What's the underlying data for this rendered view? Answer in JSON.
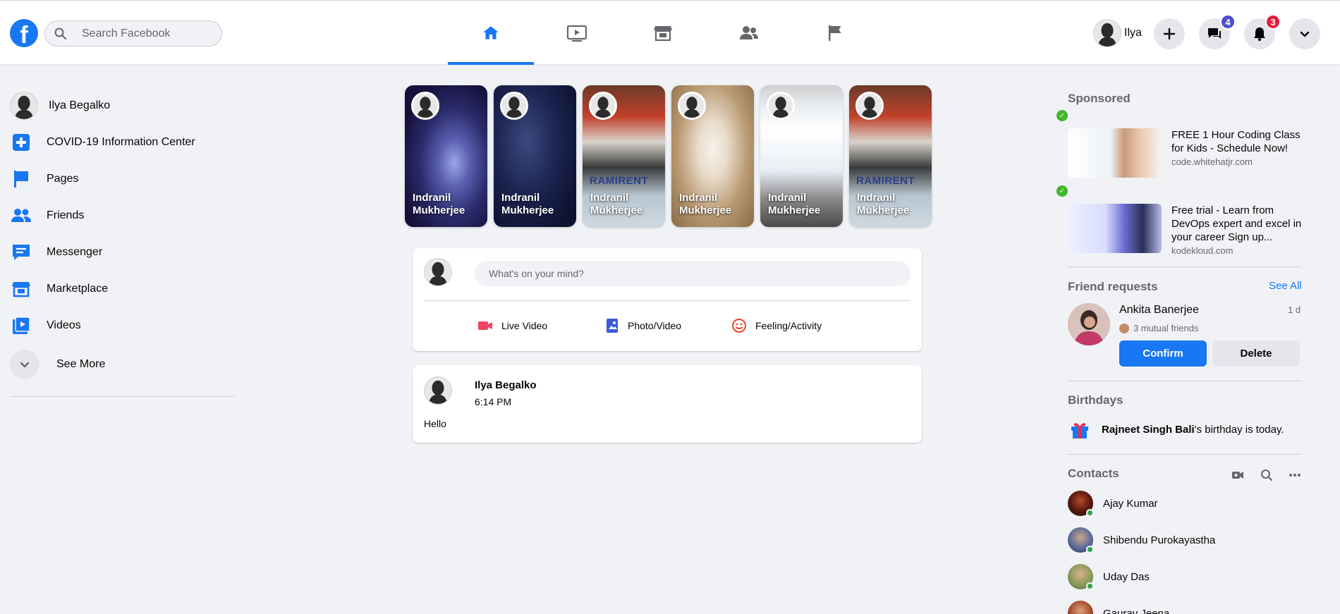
{
  "header": {
    "logo": "f",
    "search_placeholder": "Search Facebook",
    "nav_tabs": [
      {
        "name": "home",
        "icon": "home-icon",
        "active": true
      },
      {
        "name": "watch",
        "icon": "watch-icon",
        "active": false
      },
      {
        "name": "marketplace",
        "icon": "marketplace-icon",
        "active": false
      },
      {
        "name": "groups",
        "icon": "groups-icon",
        "active": false
      },
      {
        "name": "pages",
        "icon": "flag-icon",
        "active": false
      }
    ],
    "user_name": "Ilya",
    "messenger_badge": "4",
    "notifications_badge": "3",
    "accent": "#1877f2",
    "badge_colors": {
      "messenger": "#4b4fd1",
      "notifications": "#e41e3f"
    }
  },
  "left_sidebar": {
    "profile_name": "Ilya Begalko",
    "items": [
      {
        "label": "COVID-19 Information Center",
        "icon": "covid-plus-icon"
      },
      {
        "label": "Pages",
        "icon": "flag-icon"
      },
      {
        "label": "Friends",
        "icon": "friends-icon"
      },
      {
        "label": "Messenger",
        "icon": "messenger-icon"
      },
      {
        "label": "Marketplace",
        "icon": "marketplace-icon"
      },
      {
        "label": "Videos",
        "icon": "videos-icon"
      }
    ],
    "see_more": "See More"
  },
  "stories": [
    {
      "name": "Indranil Mukherjee",
      "overlay": ""
    },
    {
      "name": "Indranil Mukherjee",
      "overlay": ""
    },
    {
      "name": "Indranil Mukherjee",
      "overlay": "RAMIRENT"
    },
    {
      "name": "Indranil Mukherjee",
      "overlay": ""
    },
    {
      "name": "Indranil Mukherjee",
      "overlay": ""
    },
    {
      "name": "Indranil Mukherjee",
      "overlay": "RAMIRENT"
    }
  ],
  "composer": {
    "placeholder": "What's on your mind?",
    "actions": [
      {
        "label": "Live Video",
        "icon": "live-video-icon",
        "color": "#f3425f"
      },
      {
        "label": "Photo/Video",
        "icon": "photo-icon",
        "color": "#45bd62"
      },
      {
        "label": "Feeling/Activity",
        "icon": "feeling-icon",
        "color": "#f7b928"
      }
    ]
  },
  "post": {
    "author": "Ilya Begalko",
    "time": "6:14 PM",
    "text": "Hello"
  },
  "right_sidebar": {
    "sponsored_title": "Sponsored",
    "ads": [
      {
        "title": "FREE 1 Hour Coding Class for Kids - Schedule Now!",
        "domain": "code.whitehatjr.com"
      },
      {
        "title": "Free trial - Learn from DevOps expert and excel in your career Sign up...",
        "domain": "kodekloud.com"
      }
    ],
    "friend_requests": {
      "title": "Friend requests",
      "see_all": "See All",
      "name": "Ankita Banerjee",
      "time": "1 d",
      "mutual": "3 mutual friends",
      "confirm": "Confirm",
      "delete": "Delete"
    },
    "birthdays": {
      "title": "Birthdays",
      "name": "Rajneet Singh Bali",
      "suffix": "'s birthday is today."
    },
    "contacts": {
      "title": "Contacts",
      "list": [
        {
          "name": "Ajay Kumar"
        },
        {
          "name": "Shibendu Purokayastha"
        },
        {
          "name": "Uday Das"
        },
        {
          "name": "Gaurav Jeena"
        }
      ]
    }
  }
}
